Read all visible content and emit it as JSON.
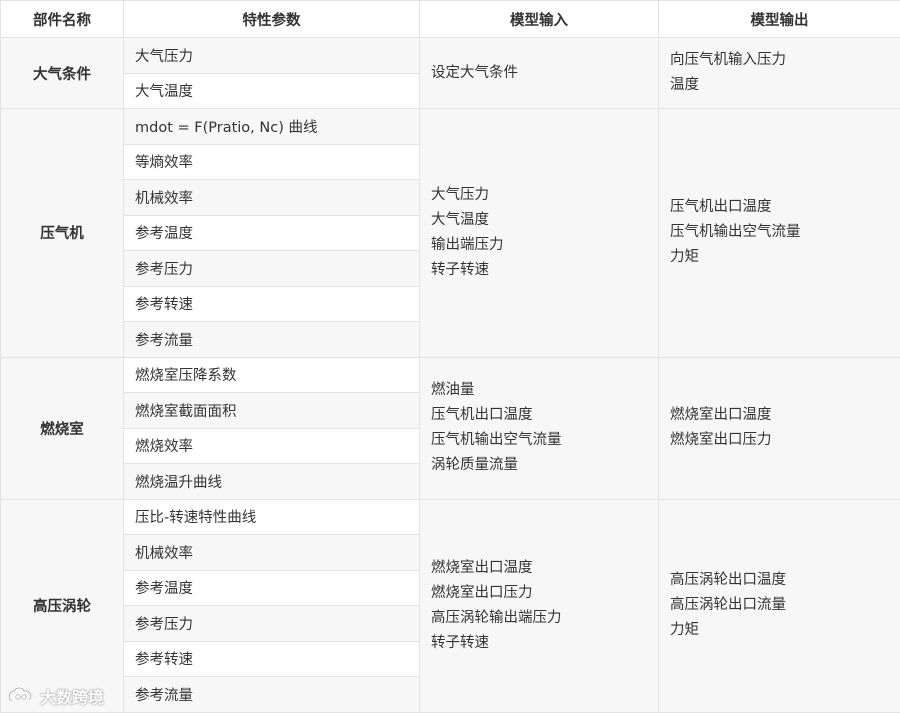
{
  "headers": [
    "部件名称",
    "特性参数",
    "模型输入",
    "模型输出"
  ],
  "groups": [
    {
      "name": "大气条件",
      "params": [
        "大气压力",
        "大气温度"
      ],
      "inputs": [
        "设定大气条件"
      ],
      "outputs": [
        "向压气机输入压力",
        "温度"
      ]
    },
    {
      "name": "压气机",
      "params": [
        "mdot = F(Pratio, Nc) 曲线",
        "等熵效率",
        "机械效率",
        "参考温度",
        "参考压力",
        "参考转速",
        "参考流量"
      ],
      "inputs": [
        "大气压力",
        "大气温度",
        "输出端压力",
        "转子转速"
      ],
      "outputs": [
        "压气机出口温度",
        "压气机输出空气流量",
        "力矩"
      ]
    },
    {
      "name": "燃烧室",
      "params": [
        "燃烧室压降系数",
        "燃烧室截面面积",
        "燃烧效率",
        "燃烧温升曲线"
      ],
      "inputs": [
        "燃油量",
        "压气机出口温度",
        "压气机输出空气流量",
        "涡轮质量流量"
      ],
      "outputs": [
        "燃烧室出口温度",
        "燃烧室出口压力"
      ]
    },
    {
      "name": "高压涡轮",
      "params": [
        "压比-转速特性曲线",
        "机械效率",
        "参考温度",
        "参考压力",
        "参考转速",
        "参考流量"
      ],
      "inputs": [
        "燃烧室出口温度",
        "燃烧室出口压力",
        "高压涡轮输出端压力",
        "转子转速"
      ],
      "outputs": [
        "高压涡轮出口温度",
        "高压涡轮出口流量",
        "力矩"
      ]
    }
  ],
  "watermark": {
    "text": "大数跨境",
    "icon": "brand-logo-icon"
  },
  "colors": {
    "shaded": "#f7f7f7",
    "white": "#ffffff",
    "border": "#e3e3e3",
    "text": "#333333"
  }
}
